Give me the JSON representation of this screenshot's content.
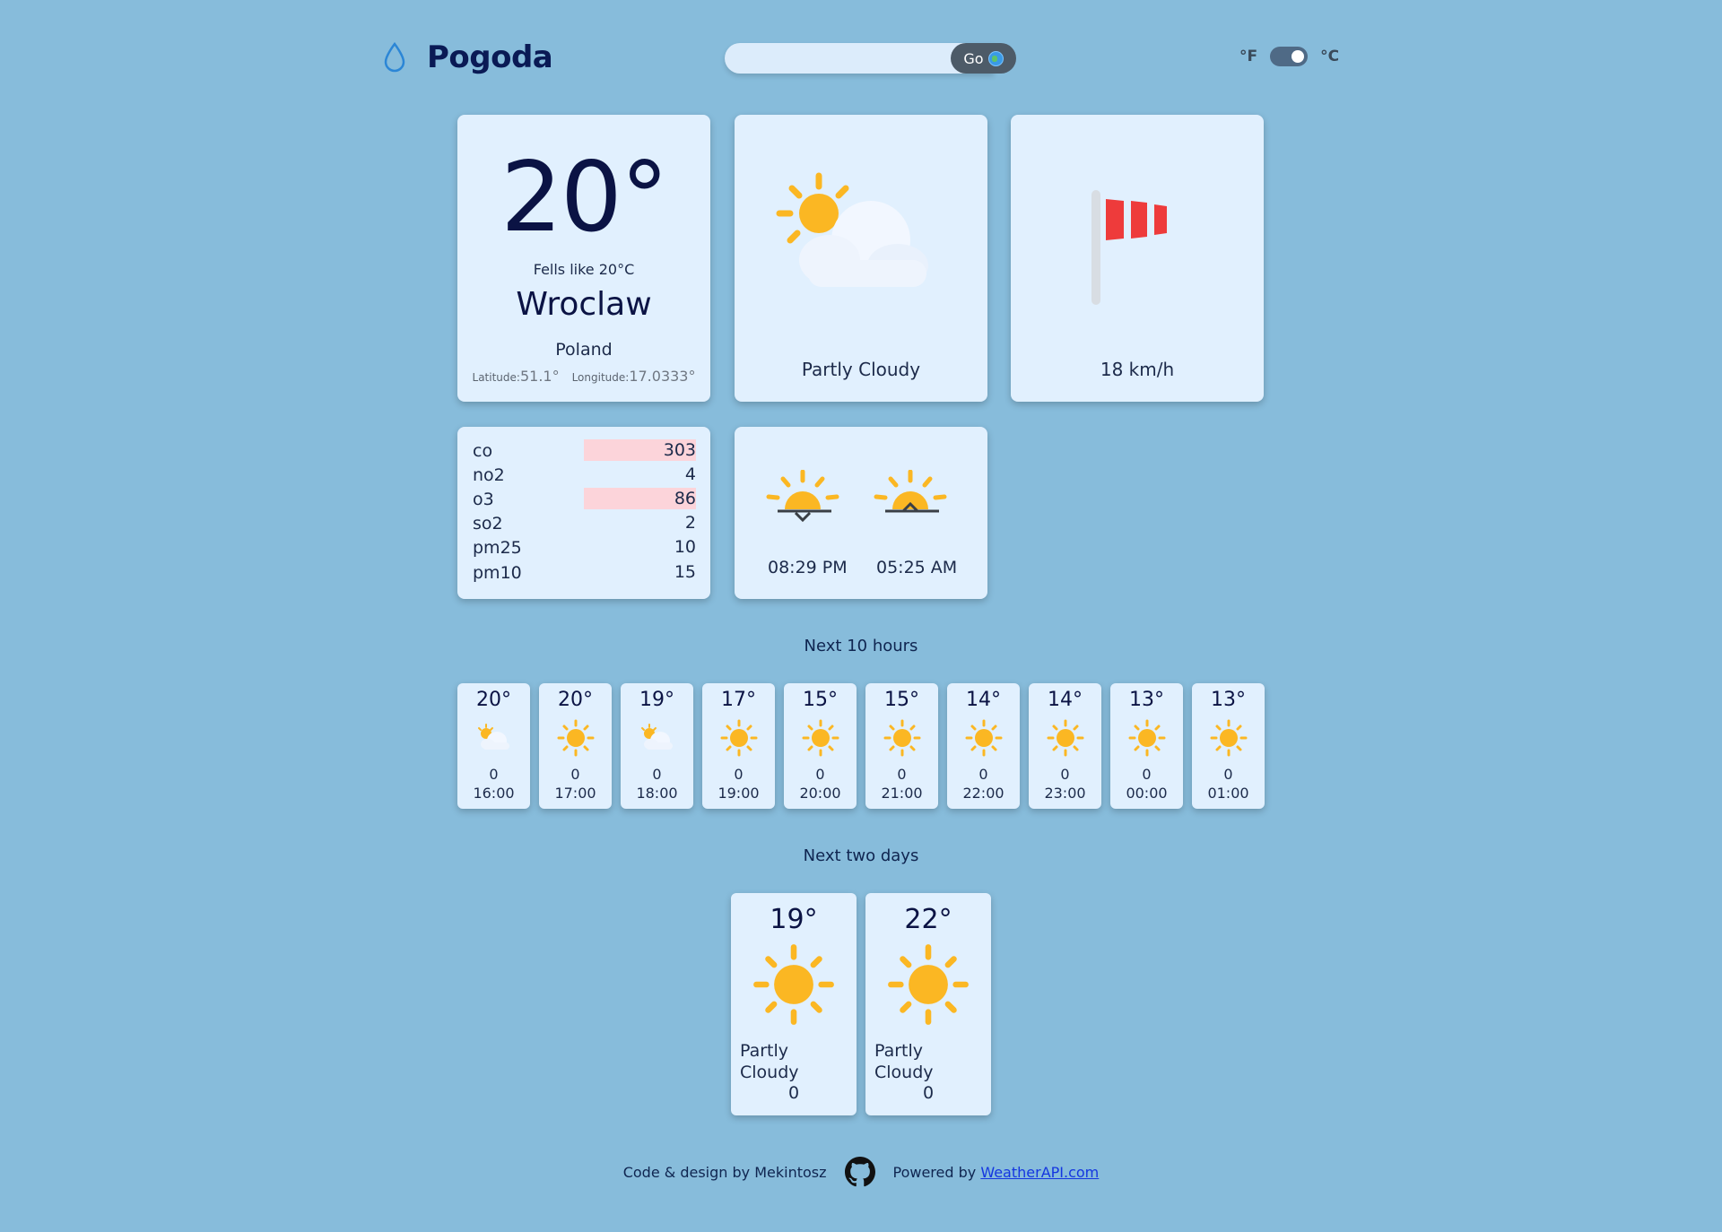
{
  "header": {
    "brand": "Pogoda",
    "search_value": "",
    "search_placeholder": "",
    "go_label": "Go",
    "unit_f": "°F",
    "unit_c": "°C",
    "unit_selected": "°C"
  },
  "current": {
    "temp": "20°",
    "feels_like": "Fells like 20°C",
    "city": "Wroclaw",
    "country": "Poland",
    "latitude_label": "Latitude:",
    "latitude": "51.1°",
    "longitude_label": "Longitude:",
    "longitude": "17.0333°",
    "condition": "Partly Cloudy",
    "wind": "18 km/h"
  },
  "air_quality": [
    {
      "key": "co",
      "value": "303",
      "highlight": true
    },
    {
      "key": "no2",
      "value": "4",
      "highlight": false
    },
    {
      "key": "o3",
      "value": "86",
      "highlight": true
    },
    {
      "key": "so2",
      "value": "2",
      "highlight": false
    },
    {
      "key": "pm25",
      "value": "10",
      "highlight": false
    },
    {
      "key": "pm10",
      "value": "15",
      "highlight": false
    }
  ],
  "sun": {
    "sunset": "08:29 PM",
    "sunrise": "05:25 AM"
  },
  "hourly_title": "Next 10 hours",
  "hourly": [
    {
      "temp": "20°",
      "icon": "partly-cloudy-icon",
      "precip": "0",
      "time": "16:00"
    },
    {
      "temp": "20°",
      "icon": "sun-icon",
      "precip": "0",
      "time": "17:00"
    },
    {
      "temp": "19°",
      "icon": "partly-cloudy-icon",
      "precip": "0",
      "time": "18:00"
    },
    {
      "temp": "17°",
      "icon": "sun-icon",
      "precip": "0",
      "time": "19:00"
    },
    {
      "temp": "15°",
      "icon": "sun-icon",
      "precip": "0",
      "time": "20:00"
    },
    {
      "temp": "15°",
      "icon": "sun-icon",
      "precip": "0",
      "time": "21:00"
    },
    {
      "temp": "14°",
      "icon": "sun-icon",
      "precip": "0",
      "time": "22:00"
    },
    {
      "temp": "14°",
      "icon": "sun-icon",
      "precip": "0",
      "time": "23:00"
    },
    {
      "temp": "13°",
      "icon": "sun-icon",
      "precip": "0",
      "time": "00:00"
    },
    {
      "temp": "13°",
      "icon": "sun-icon",
      "precip": "0",
      "time": "01:00"
    }
  ],
  "daily_title": "Next two days",
  "daily": [
    {
      "temp": "19°",
      "icon": "sun-icon",
      "condition": "Partly Cloudy",
      "precip": "0"
    },
    {
      "temp": "22°",
      "icon": "sun-icon",
      "condition": "Partly Cloudy",
      "precip": "0"
    }
  ],
  "footer": {
    "credit": "Code & design by Mekintosz",
    "powered": "Powered by",
    "api_link": "WeatherAPI.com"
  },
  "colors": {
    "background": "#87bcdb",
    "card": "#e1f0fe",
    "highlight": "#fcd4da",
    "sun": "#fbb723",
    "windsock": "#ee3b3b"
  }
}
